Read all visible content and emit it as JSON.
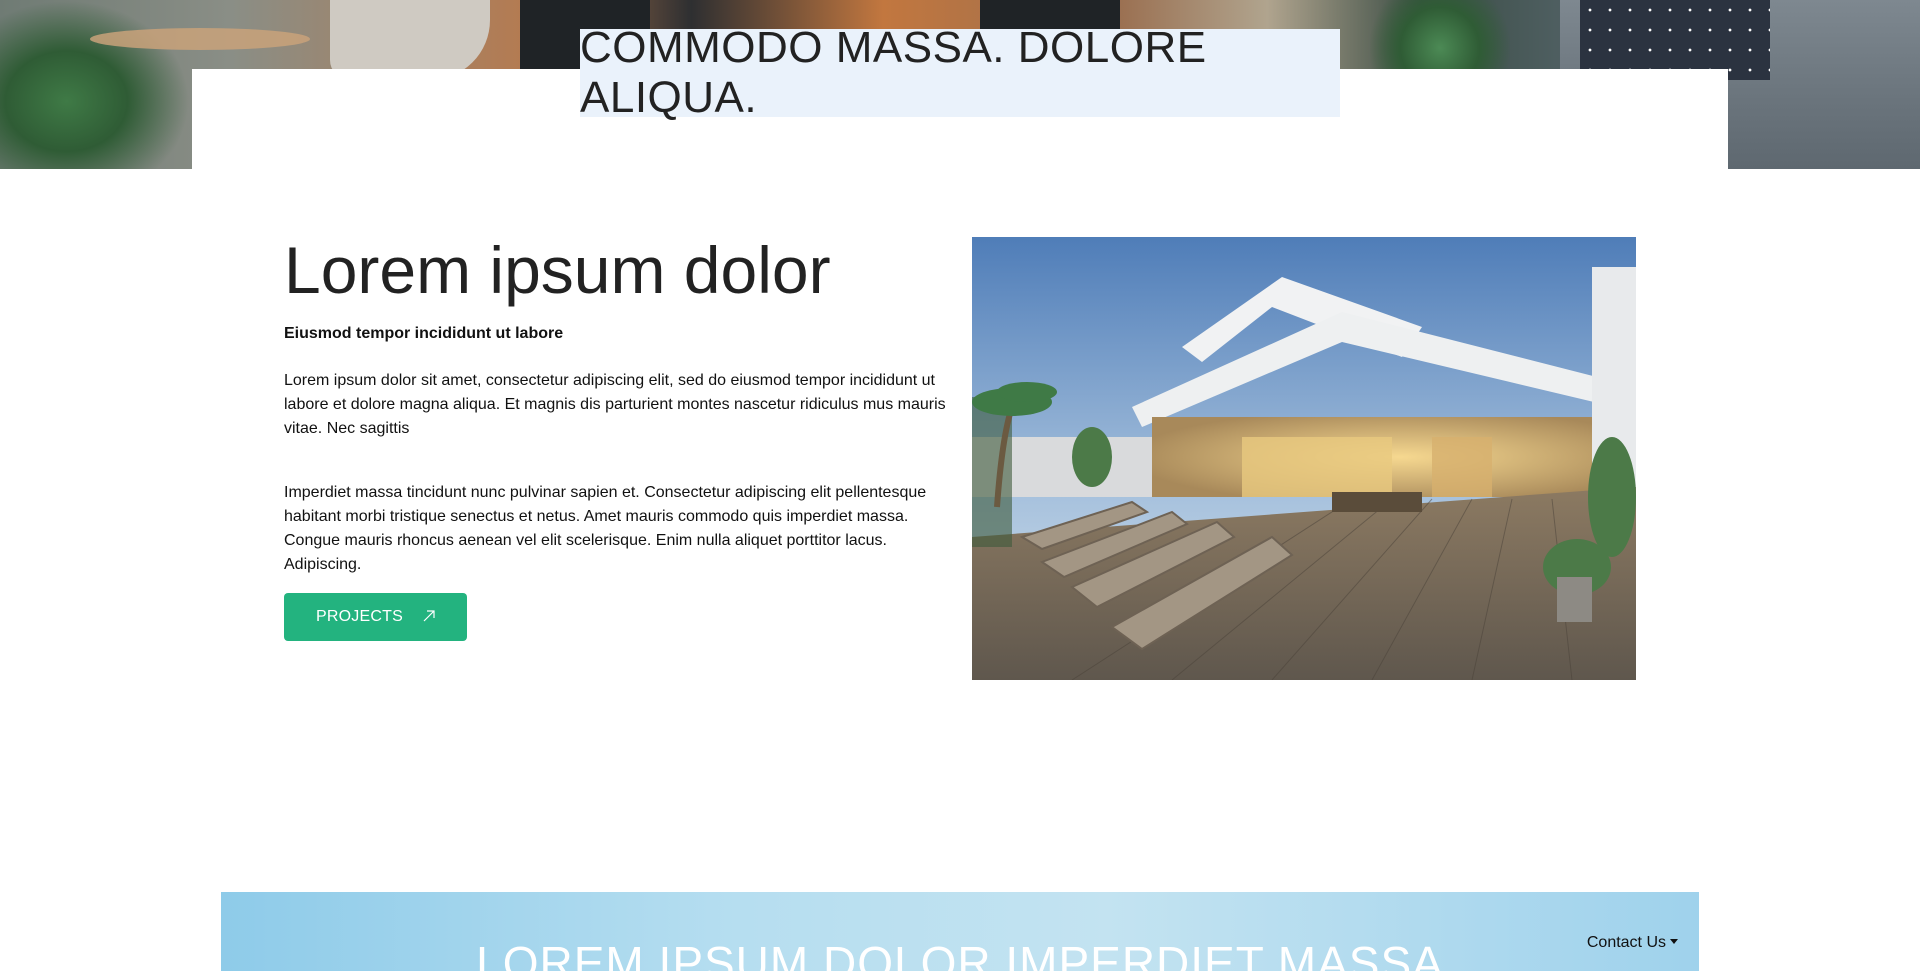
{
  "header": {
    "title": "COMMODO MASSA. DOLORE ALIQUA."
  },
  "intro": {
    "heading": "Lorem ipsum dolor",
    "subheading": "Eiusmod tempor incididunt ut labore",
    "paragraph_1": "Lorem ipsum dolor sit amet, consectetur adipiscing elit, sed do eiusmod tempor incididunt ut labore et dolore magna aliqua. Et magnis dis parturient montes nascetur ridiculus mus mauris vitae. Nec sagittis",
    "paragraph_2": "Imperdiet massa tincidunt nunc pulvinar sapien et. Consectetur adipiscing elit pellentesque habitant morbi tristique senectus et netus. Amet mauris commodo quis imperdiet massa. Congue mauris rhoncus aenean vel elit scelerisque. Enim nulla aliquet porttitor lacus. Adipiscing.",
    "button_label": "PROJECTS",
    "button_icon": "arrow-up-right-icon"
  },
  "banner": {
    "title": "LOREM IPSUM DOLOR IMPERDIET MASSA",
    "contact_label": "Contact Us"
  },
  "colors": {
    "accent": "#23b37f",
    "title_box": "#eaf2fb",
    "banner_sky": "#a9d8ef"
  }
}
